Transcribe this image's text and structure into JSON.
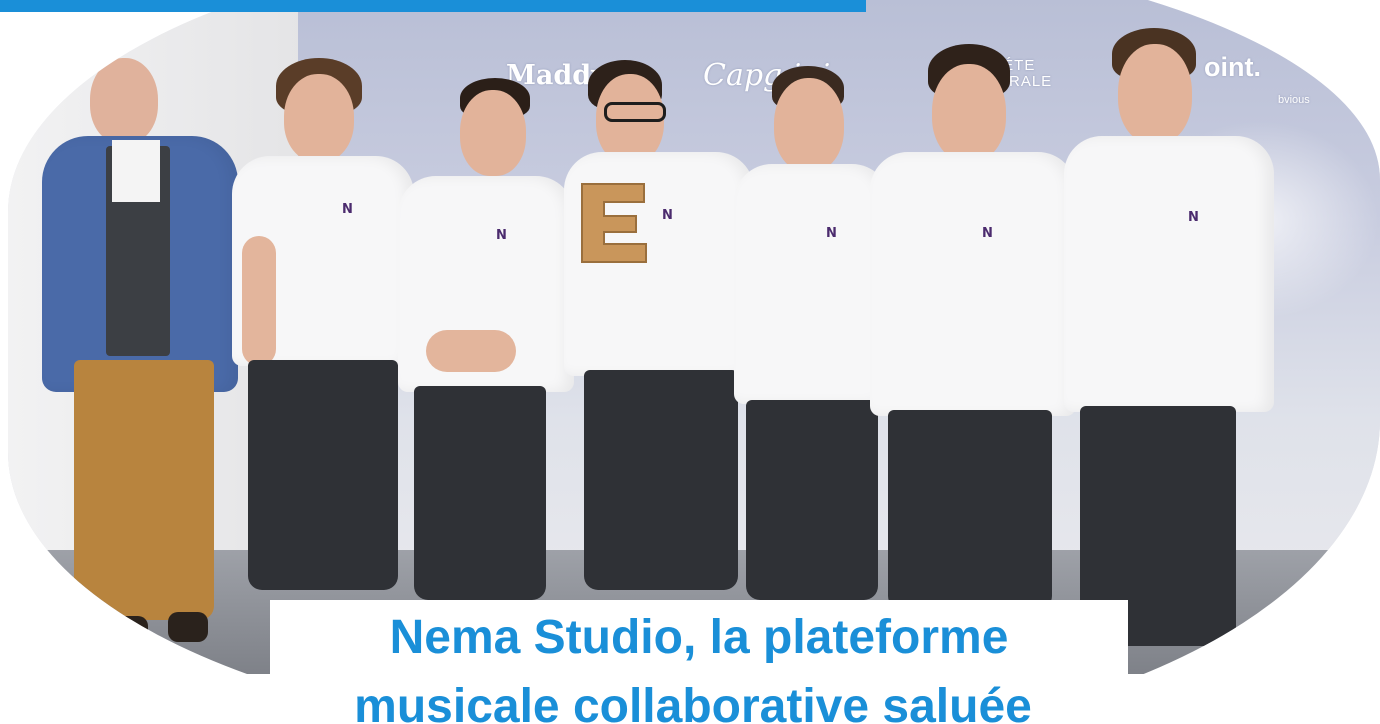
{
  "banner": {
    "color": "#1a8fd8"
  },
  "photo": {
    "description_icon": "team-award-photo",
    "sponsors": [
      "Maddyness",
      "Capgemini",
      "SOCIÉTÉ GÉNÉRALE",
      "point",
      "Obvious"
    ],
    "sponsor_visible_text": {
      "s1": "Maddy ss",
      "s2": "Capg   ini",
      "s3a": "IÉTE",
      "s3b": "ÉRALE",
      "s4": "oint.",
      "s5": "bvious"
    },
    "shirt_logo": "N"
  },
  "headline": {
    "line1": "Nema Studio, la plateforme",
    "line2": "musicale collaborative saluée",
    "color": "#1a8fd8"
  }
}
